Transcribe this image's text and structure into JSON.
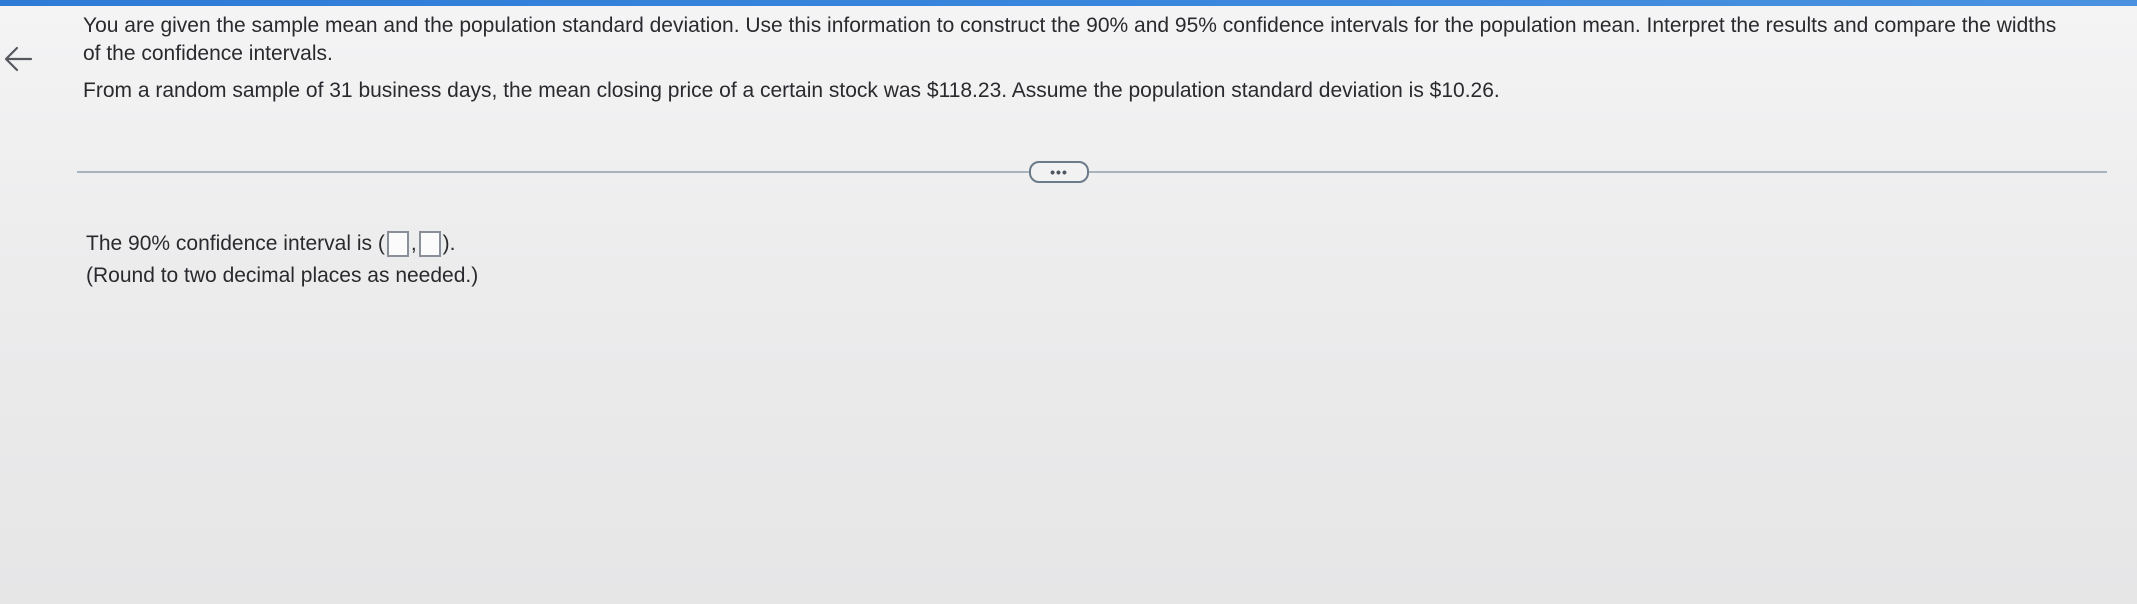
{
  "nav": {
    "back_icon": "left-arrow-icon"
  },
  "question": {
    "instruction": "You are given the sample mean and the population standard deviation. Use this information to construct the 90% and 95% confidence intervals for the population mean. Interpret the results and compare the widths of the confidence intervals.",
    "given": "From a random sample of 31 business days, the mean closing price of a certain stock was $118.23. Assume the population standard deviation is $10.26."
  },
  "divider": {
    "more_label": "•••"
  },
  "answer": {
    "prefix": "The 90% confidence interval is (",
    "separator": ",",
    "suffix": ").",
    "lower_value": "",
    "upper_value": "",
    "note": "(Round to two decimal places as needed.)"
  },
  "colors": {
    "accent": "#2e7bd6",
    "background": "#ececed",
    "text": "#2a2a2e"
  }
}
